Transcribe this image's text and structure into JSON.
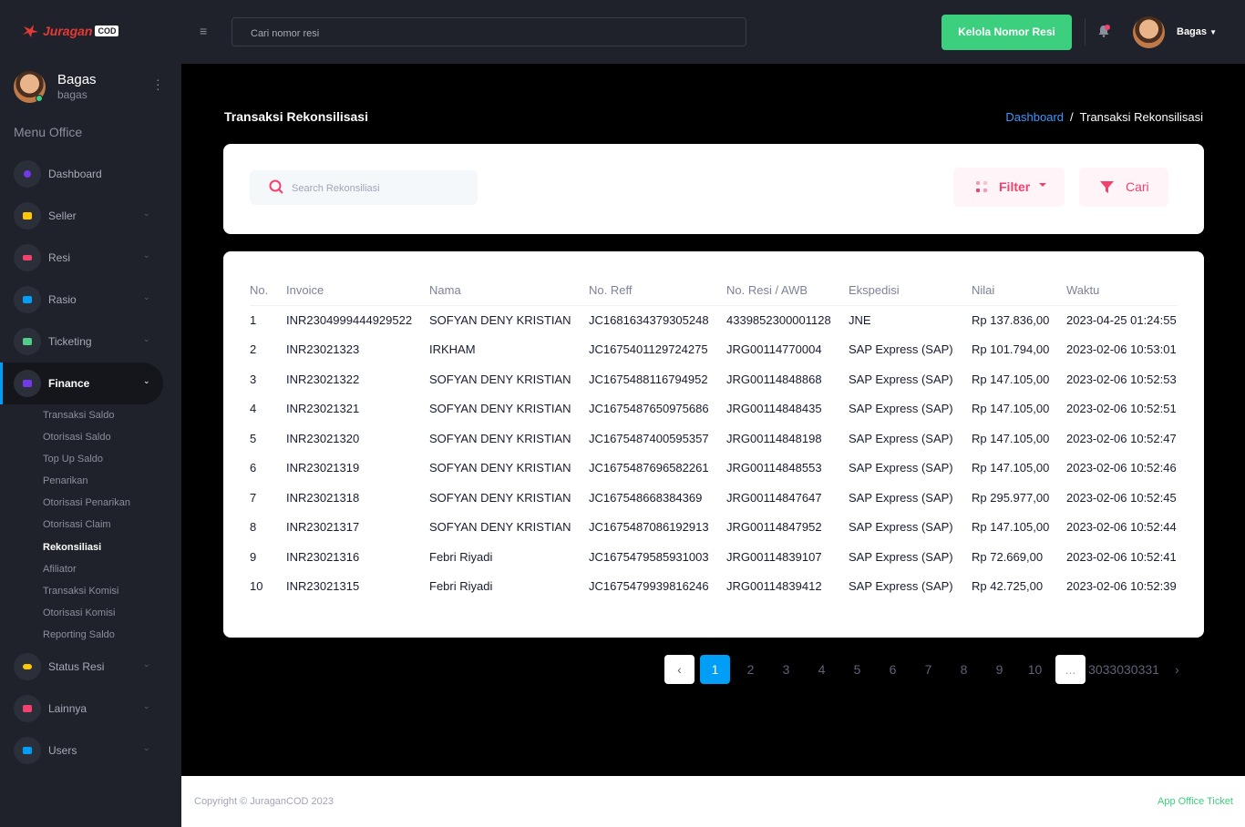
{
  "topbar": {
    "logo_brand": "Juragan",
    "logo_badge": "COD",
    "search_placeholder": "Cari nomor resi",
    "kelola_button": "Kelola Nomor Resi",
    "user_name": "Bagas"
  },
  "sidebar": {
    "name": "Bagas",
    "username": "bagas",
    "section_title": "Menu Office",
    "items": [
      {
        "label": "Dashboard",
        "icon": "dashboard-icon",
        "color": "#7239ea"
      },
      {
        "label": "Seller",
        "icon": "users-icon",
        "color": "#ffc700"
      },
      {
        "label": "Resi",
        "icon": "list-icon",
        "color": "#f1416c"
      },
      {
        "label": "Rasio",
        "icon": "chart-icon",
        "color": "#009ef7"
      },
      {
        "label": "Ticketing",
        "icon": "ticket-icon",
        "color": "#50cd89"
      },
      {
        "label": "Finance",
        "icon": "finance-icon",
        "color": "#7239ea"
      },
      {
        "label": "Status Resi",
        "icon": "toggle-icon",
        "color": "#ffc700"
      },
      {
        "label": "Lainnya",
        "icon": "message-icon",
        "color": "#f1416c"
      },
      {
        "label": "Users",
        "icon": "user-icon",
        "color": "#009ef7"
      }
    ],
    "finance_sub": [
      "Transaksi Saldo",
      "Otorisasi Saldo",
      "Top Up Saldo",
      "Penarikan",
      "Otorisasi Penarikan",
      "Otorisasi Claim",
      "Rekonsiliasi",
      "Afiliator",
      "Transaksi Komisi",
      "Otorisasi Komisi",
      "Reporting Saldo"
    ]
  },
  "page": {
    "title": "Transaksi Rekonsilisasi",
    "breadcrumb_home": "Dashboard",
    "breadcrumb_current": "Transaksi Rekonsilisasi",
    "search_placeholder": "Search Rekonsiliasi",
    "filter_label": "Filter",
    "cari_label": "Cari"
  },
  "table": {
    "headers": [
      "No.",
      "Invoice",
      "Nama",
      "No. Reff",
      "No. Resi / AWB",
      "Ekspedisi",
      "Nilai",
      "Waktu"
    ],
    "rows": [
      [
        "1",
        "INR2304999444929522",
        "SOFYAN DENY KRISTIAN",
        "JC1681634379305248",
        "4339852300001128",
        "JNE",
        "Rp 137.836,00",
        "2023-04-25 01:24:55"
      ],
      [
        "2",
        "INR23021323",
        "IRKHAM",
        "JC1675401129724275",
        "JRG00114770004",
        "SAP Express (SAP)",
        "Rp 101.794,00",
        "2023-02-06 10:53:01"
      ],
      [
        "3",
        "INR23021322",
        "SOFYAN DENY KRISTIAN",
        "JC1675488116794952",
        "JRG00114848868",
        "SAP Express (SAP)",
        "Rp 147.105,00",
        "2023-02-06 10:52:53"
      ],
      [
        "4",
        "INR23021321",
        "SOFYAN DENY KRISTIAN",
        "JC1675487650975686",
        "JRG00114848435",
        "SAP Express (SAP)",
        "Rp 147.105,00",
        "2023-02-06 10:52:51"
      ],
      [
        "5",
        "INR23021320",
        "SOFYAN DENY KRISTIAN",
        "JC1675487400595357",
        "JRG00114848198",
        "SAP Express (SAP)",
        "Rp 147.105,00",
        "2023-02-06 10:52:47"
      ],
      [
        "6",
        "INR23021319",
        "SOFYAN DENY KRISTIAN",
        "JC1675487696582261",
        "JRG00114848553",
        "SAP Express (SAP)",
        "Rp 147.105,00",
        "2023-02-06 10:52:46"
      ],
      [
        "7",
        "INR23021318",
        "SOFYAN DENY KRISTIAN",
        "JC167548668384369",
        "JRG00114847647",
        "SAP Express (SAP)",
        "Rp 295.977,00",
        "2023-02-06 10:52:45"
      ],
      [
        "8",
        "INR23021317",
        "SOFYAN DENY KRISTIAN",
        "JC1675487086192913",
        "JRG00114847952",
        "SAP Express (SAP)",
        "Rp 147.105,00",
        "2023-02-06 10:52:44"
      ],
      [
        "9",
        "INR23021316",
        "Febri Riyadi",
        "JC1675479585931003",
        "JRG00114839107",
        "SAP Express (SAP)",
        "Rp 72.669,00",
        "2023-02-06 10:52:41"
      ],
      [
        "10",
        "INR23021315",
        "Febri Riyadi",
        "JC1675479939816246",
        "JRG00114839412",
        "SAP Express (SAP)",
        "Rp 42.725,00",
        "2023-02-06 10:52:39"
      ]
    ]
  },
  "pagination": {
    "prev": "‹",
    "pages": [
      "1",
      "2",
      "3",
      "4",
      "5",
      "6",
      "7",
      "8",
      "9",
      "10"
    ],
    "ellipsis": "...",
    "last_pages": "3033030331",
    "next": "›"
  },
  "footer": {
    "copyright": "Copyright © JuraganCOD 2023",
    "app_link": "App Office Ticket"
  }
}
